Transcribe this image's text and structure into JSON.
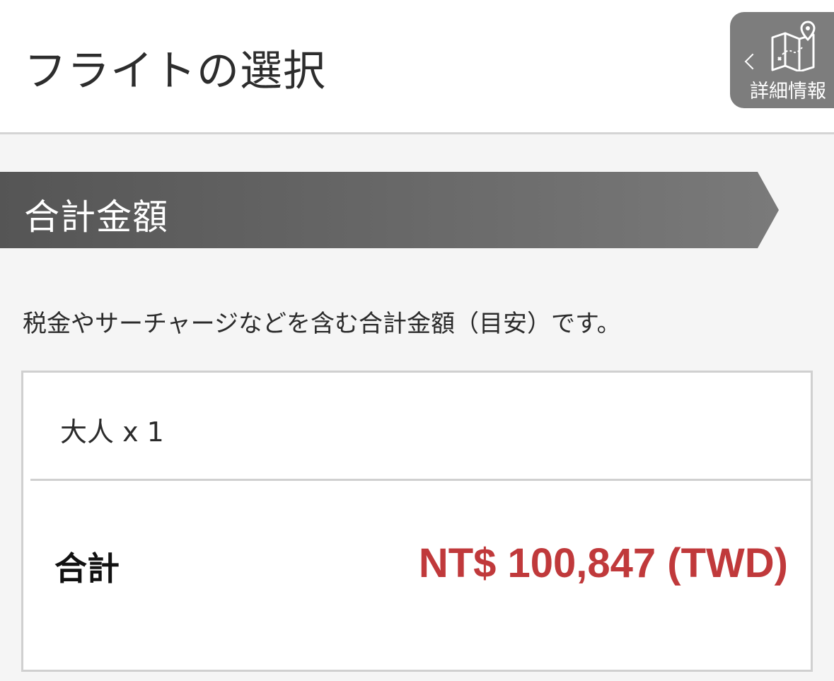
{
  "header": {
    "title": "フライトの選択",
    "details_button": {
      "label": "詳細情報",
      "icon": "map-icon",
      "chevron": "chevron-left-icon"
    }
  },
  "section": {
    "title": "合計金額"
  },
  "description": "税金やサーチャージなどを含む合計金額（目安）です。",
  "summary": {
    "passenger": "大人 x 1",
    "total_label": "合計",
    "total_amount": "NT$ 100,847 (TWD)"
  },
  "colors": {
    "banner_start": "#555555",
    "banner_end": "#7a7a7a",
    "price": "#c0393b",
    "details_button_bg": "#7d7d7d"
  }
}
